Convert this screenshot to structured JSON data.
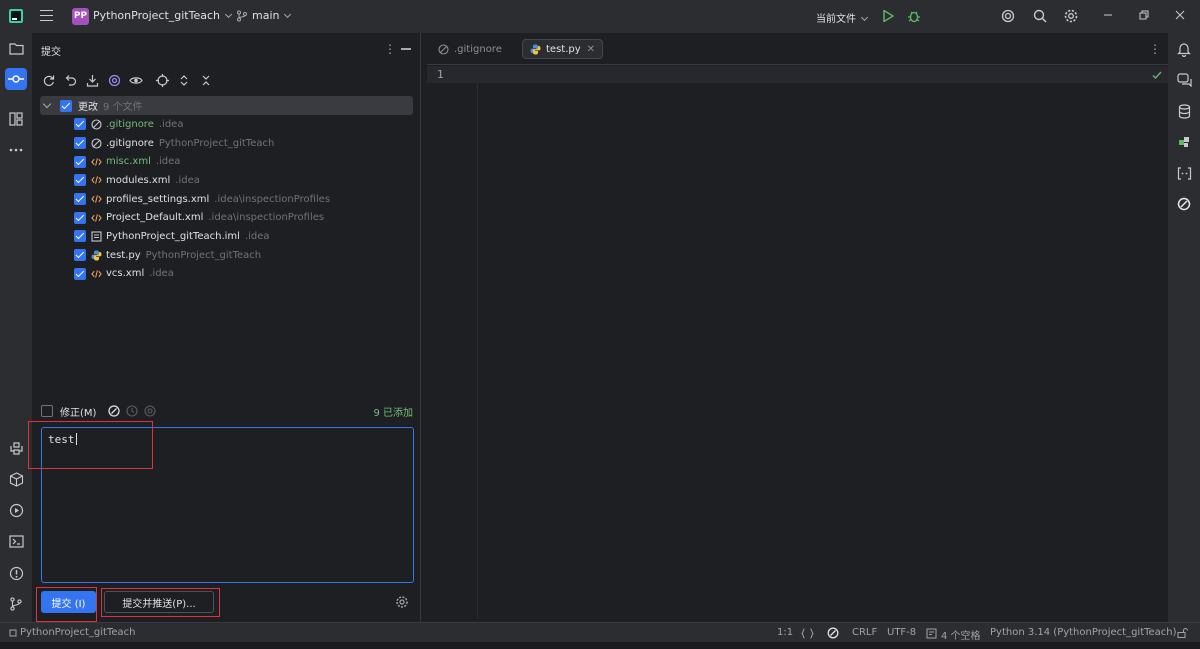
{
  "titlebar": {
    "project_badge": "PP",
    "project_name": "PythonProject_gitTeach",
    "branch": "main",
    "run_config": "当前文件"
  },
  "commit_panel": {
    "title": "提交",
    "tree_root": {
      "label": "更改",
      "count": "9 个文件"
    },
    "files": [
      {
        "name": ".gitignore",
        "path": ".idea",
        "icon": "ignore-icon",
        "green": true
      },
      {
        "name": ".gitignore",
        "path": "PythonProject_gitTeach",
        "icon": "ignore-icon",
        "green": false
      },
      {
        "name": "misc.xml",
        "path": ".idea",
        "icon": "xml-icon",
        "green": true
      },
      {
        "name": "modules.xml",
        "path": ".idea",
        "icon": "xml-icon",
        "green": false
      },
      {
        "name": "profiles_settings.xml",
        "path": ".idea\\inspectionProfiles",
        "icon": "xml-icon",
        "green": false
      },
      {
        "name": "Project_Default.xml",
        "path": ".idea\\inspectionProfiles",
        "icon": "xml-icon",
        "green": false
      },
      {
        "name": "PythonProject_gitTeach.iml",
        "path": ".idea",
        "icon": "module-icon",
        "green": false
      },
      {
        "name": "test.py",
        "path": "PythonProject_gitTeach",
        "icon": "python-icon",
        "green": false
      },
      {
        "name": "vcs.xml",
        "path": ".idea",
        "icon": "xml-icon",
        "green": false
      }
    ],
    "amend_label": "修正(M)",
    "added_label": "9 已添加",
    "message": "test",
    "commit_button": "提交 (I)",
    "commit_push_button": "提交并推送(P)..."
  },
  "editor": {
    "tabs": [
      {
        "label": ".gitignore",
        "active": false
      },
      {
        "label": "test.py",
        "active": true
      }
    ],
    "line_number": "1"
  },
  "statusbar": {
    "project": "PythonProject_gitTeach",
    "position": "1:1",
    "line_separator": "CRLF",
    "encoding": "UTF-8",
    "indent": "4 个空格",
    "interpreter": "Python 3.14 (PythonProject_gitTeach)"
  },
  "colors": {
    "accent": "#3574f0",
    "added_green": "#73bd79",
    "highlight_red": "#e0323a"
  }
}
